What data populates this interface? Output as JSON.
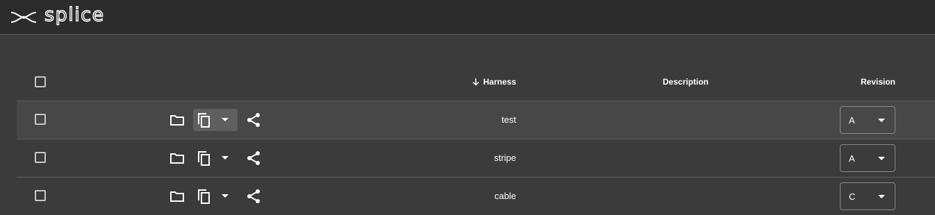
{
  "app": {
    "name": "splice"
  },
  "table": {
    "columns": {
      "harness": "Harness",
      "description": "Description",
      "revision": "Revision"
    },
    "sort": {
      "column": "harness",
      "direction": "descending",
      "icon": "arrow-down-icon"
    },
    "rows": [
      {
        "harness": "test",
        "description": "",
        "revision": "A"
      },
      {
        "harness": "stripe",
        "description": "",
        "revision": "A"
      },
      {
        "harness": "cable",
        "description": "",
        "revision": "C"
      }
    ]
  },
  "icons": {
    "logo": "splice-logo-icon",
    "checkbox": "checkbox-icon",
    "folder": "folder-icon",
    "copy": "copy-icon",
    "dropdown": "caret-down-icon",
    "share": "share-icon"
  },
  "colors": {
    "topbar": "#2c2c2c",
    "background": "#3b3b3b",
    "row_hover": "#474747",
    "active_button": "#5f5f5f",
    "divider": "#5e5e5e",
    "text": "#ffffff"
  }
}
